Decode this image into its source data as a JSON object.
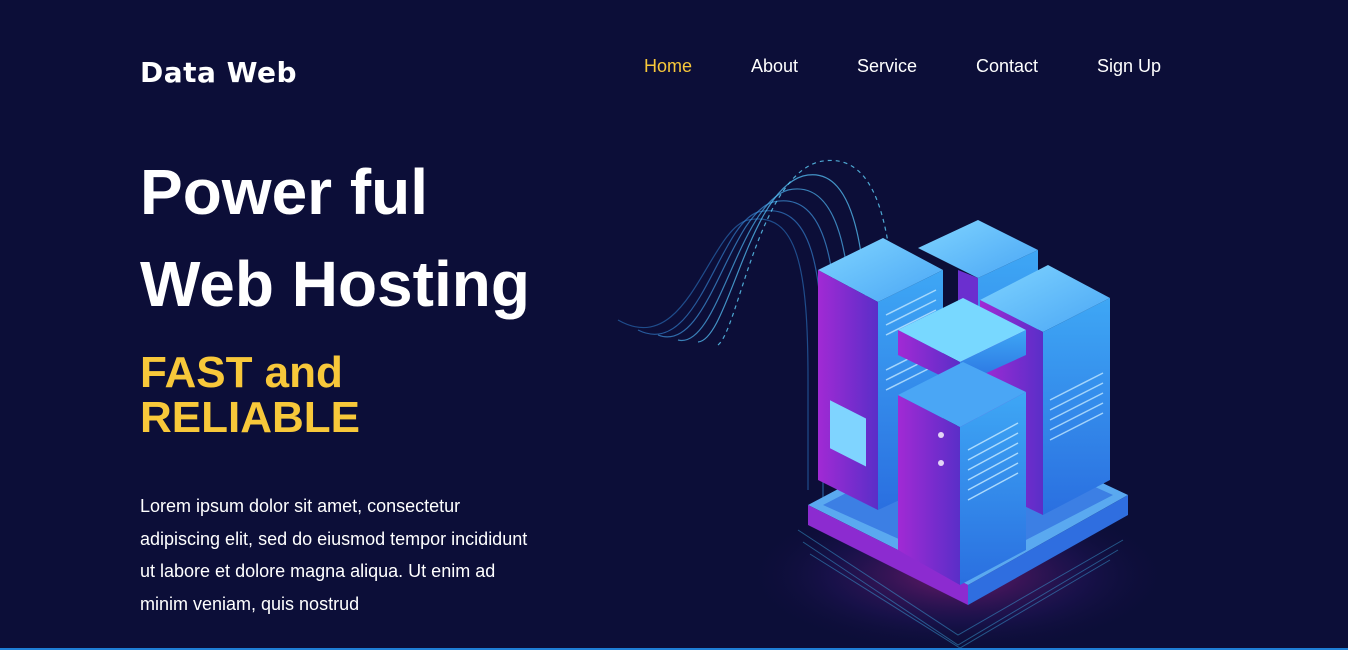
{
  "header": {
    "logo_text": "Data Web",
    "nav": [
      {
        "label": "Home",
        "active": true
      },
      {
        "label": "About",
        "active": false
      },
      {
        "label": "Service",
        "active": false
      },
      {
        "label": "Contact",
        "active": false
      },
      {
        "label": "Sign Up",
        "active": false
      }
    ]
  },
  "hero": {
    "title_line1": "Power ful",
    "title_line2": "Web Hosting",
    "subtitle_line1": "FAST and",
    "subtitle_line2": "RELIABLE",
    "description_lines": [
      "Lorem ipsum dolor sit amet, consectetur",
      "adipiscing elit, sed do eiusmod tempor incididunt",
      "ut labore et dolore magna aliqua. Ut enim ad",
      "minim veniam, quis nostrud"
    ],
    "illustration": "isometric-server-racks-illustration"
  },
  "colors": {
    "background": "#0c0e38",
    "accent": "#f8c83a",
    "text": "#ffffff",
    "server_blue": "#3d8ff0",
    "server_purple": "#7a2bd0",
    "bottom_line": "#1f7fd6"
  }
}
